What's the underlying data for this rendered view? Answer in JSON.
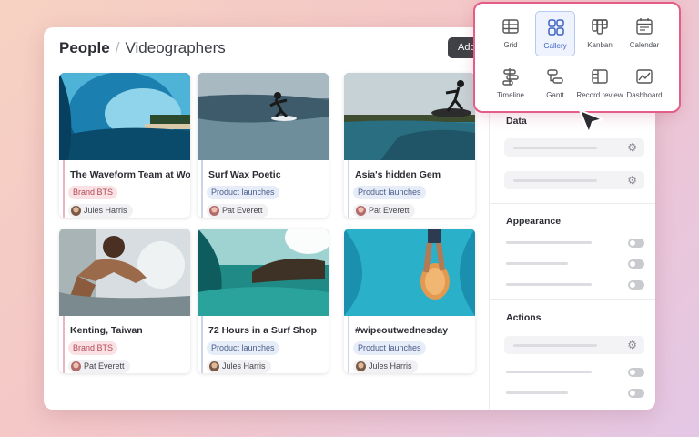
{
  "header": {
    "breadcrumb_root": "People",
    "breadcrumb_separator": "/",
    "breadcrumb_leaf": "Videographers",
    "add_button_label": "Add"
  },
  "cards": [
    {
      "title": "The Waveform Team at Work",
      "tag": "Brand BTS",
      "person": "Jules Harris"
    },
    {
      "title": "Surf Wax Poetic",
      "tag": "Product launches",
      "person": "Pat Everett"
    },
    {
      "title": "Asia's hidden Gem",
      "tag": "Product launches",
      "person": "Pat Everett"
    },
    {
      "title": "Kenting, Taiwan",
      "tag": "Brand BTS",
      "person": "Pat Everett"
    },
    {
      "title": "72 Hours in a Surf Shop",
      "tag": "Product launches",
      "person": "Jules Harris"
    },
    {
      "title": "#wipeoutwednesday",
      "tag": "Product launches",
      "person": "Jules Harris"
    }
  ],
  "panel": {
    "data_title": "Data",
    "appearance_title": "Appearance",
    "actions_title": "Actions"
  },
  "view_picker": {
    "selected": "Gallery",
    "options": [
      "Grid",
      "Gallery",
      "Kanban",
      "Calendar",
      "Timeline",
      "Gantt",
      "Record review",
      "Dashboard"
    ]
  },
  "colors": {
    "accent": "#e45d86",
    "selected_view": "#3b63c4",
    "tag_brand_bts": "#b14a58",
    "tag_product_launches": "#4a5d8a"
  }
}
